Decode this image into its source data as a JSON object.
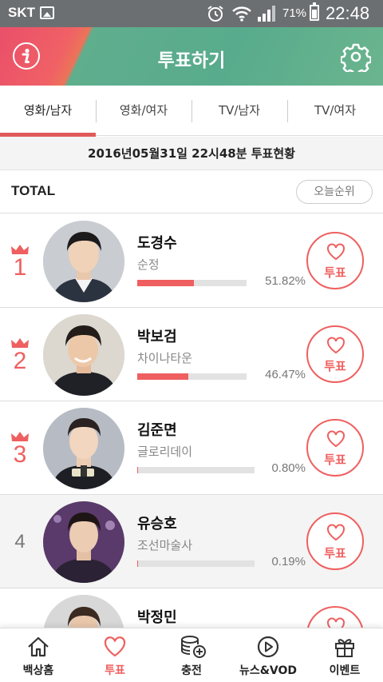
{
  "status_bar": {
    "carrier": "SKT",
    "battery": "71%",
    "time": "22:48",
    "icons": [
      "gallery-icon",
      "alarm-icon",
      "wifi-icon",
      "signal-icon",
      "battery-icon"
    ]
  },
  "header": {
    "title": "투표하기",
    "info_icon": "info-icon",
    "settings_icon": "gear-icon",
    "colors": {
      "left": "#ef5f6b",
      "right": "#5fae8e"
    }
  },
  "tabs": [
    {
      "label": "영화/남자",
      "active": true
    },
    {
      "label": "영화/여자",
      "active": false
    },
    {
      "label": "TV/남자",
      "active": false
    },
    {
      "label": "TV/여자",
      "active": false
    }
  ],
  "date_status": "2016년05월31일 22시48분 투표현황",
  "total": {
    "label": "TOTAL",
    "today_button": "오늘순위"
  },
  "entries": [
    {
      "rank": "1",
      "crown": true,
      "name": "도경수",
      "work": "순정",
      "percent": "51.82%",
      "share": 51.82,
      "vote_label": "투표"
    },
    {
      "rank": "2",
      "crown": true,
      "name": "박보검",
      "work": "차이나타운",
      "percent": "46.47%",
      "share": 46.47,
      "vote_label": "투표"
    },
    {
      "rank": "3",
      "crown": true,
      "name": "김준면",
      "work": "글로리데이",
      "percent": "0.80%",
      "share": 0.8,
      "vote_label": "투표"
    },
    {
      "rank": "4",
      "crown": false,
      "name": "유승호",
      "work": "조선마술사",
      "percent": "0.19%",
      "share": 0.19,
      "vote_label": "투표"
    },
    {
      "rank": "",
      "crown": false,
      "name": "박정민",
      "work": "",
      "percent": "",
      "share": 0,
      "vote_label": ""
    }
  ],
  "bottom_nav": [
    {
      "label": "백상홈",
      "icon": "home-icon",
      "active": false
    },
    {
      "label": "투표",
      "icon": "heart-icon",
      "active": true
    },
    {
      "label": "충전",
      "icon": "coins-add-icon",
      "active": false
    },
    {
      "label": "뉴스&VOD",
      "icon": "play-icon",
      "active": false
    },
    {
      "label": "이벤트",
      "icon": "gift-icon",
      "active": false
    }
  ],
  "accent_color": "#ef5f5f"
}
